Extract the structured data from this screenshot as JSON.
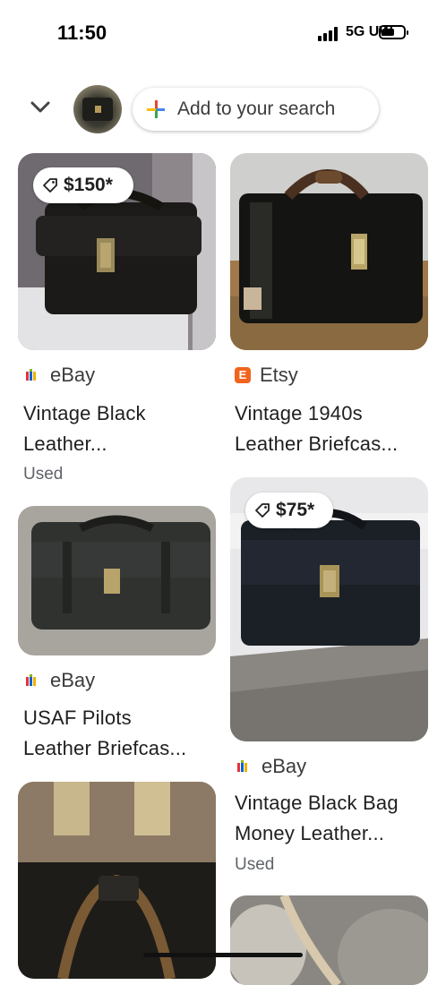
{
  "status": {
    "time": "11:50",
    "network": "5G UW"
  },
  "search": {
    "add_label": "Add to your search"
  },
  "results": [
    {
      "price": "$150*",
      "source": "eBay",
      "title_line1": "Vintage Black",
      "title_line2": "Leather...",
      "condition": "Used"
    },
    {
      "source": "Etsy",
      "etsy_letter": "E",
      "title_line1": "Vintage 1940s",
      "title_line2": "Leather Briefcas..."
    },
    {
      "source": "eBay",
      "title_line1": "USAF Pilots",
      "title_line2": "Leather Briefcas..."
    },
    {
      "price": "$75*",
      "source": "eBay",
      "title_line1": "Vintage Black Bag",
      "title_line2": "Money Leather...",
      "condition": "Used"
    }
  ],
  "colors": {
    "etsy": "#f1641e",
    "google_blue": "#4285f4",
    "google_red": "#ea4335",
    "google_yellow": "#fbbc05",
    "google_green": "#34a853"
  }
}
